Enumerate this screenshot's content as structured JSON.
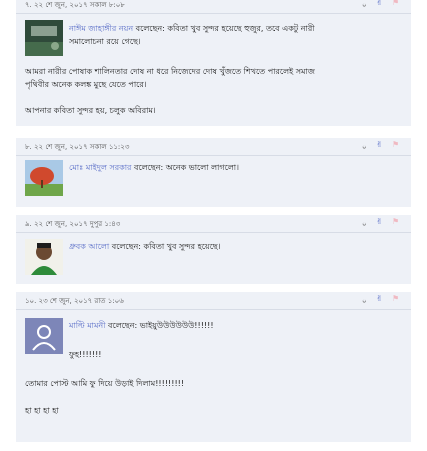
{
  "comments": [
    {
      "num": "৭. ২২ শে জুন, ২০১৭ সকাল ৮:০৮",
      "count": "০",
      "author": "নাঈম জাহাঙ্গীর নয়ন",
      "said": "বলেছেন:",
      "text": "কবিতা খুব সুন্দর হয়েছে হুজুর, তবে একটু নারী",
      "text_cont": "সমালোচনা রয়ে গেছে।",
      "paras": [
        "আমরা নারীর পোষাক শালিনতার দোষ না ধরে নিজেদের দোষ খুঁজতে শিখতে পারলেই সমাজ",
        "পৃথিবীর অনেক কলঙ্ক মুছে যেতে পারে।",
        "আপনার কবিতা সুন্দর হয়, চলুক অবিরাম।"
      ]
    },
    {
      "num": "৮. ২২ শে জুন, ২০১৭ সকাল ১১:২৩",
      "count": "০",
      "author": "মোঃ মাইদুল সরকার",
      "said": "বলেছেন:",
      "text": "অনেক ভালো লাগলো।"
    },
    {
      "num": "৯. ২২ শে জুন, ২০১৭ দুপুর ১:৪৩",
      "count": "০",
      "author": "ধ্রুবক আলো",
      "said": "বলেছেন:",
      "text": "কবিতা খুব সুন্দর হয়েছে।"
    },
    {
      "num": "১০. ২৩ শে জুন, ২০১৭ রাত ১:০৬",
      "count": "০",
      "author": "মাল্টি মামনী",
      "said": "বলেছেন:",
      "text": "ভাইয়ুউউউউউউ!!!!!!",
      "text_cont": "ফুহ!!!!!!!",
      "paras": [
        "তোমার পোস্ট আমি ফু দিয়ে উড়াই দিলাম!!!!!!!!!",
        "হা হা হা হা"
      ]
    }
  ],
  "icons": {
    "like": "thumb-icon",
    "flag": "flag-icon"
  },
  "colors": {
    "card_bg": "#eef1f7",
    "author": "#5a6ec8"
  }
}
